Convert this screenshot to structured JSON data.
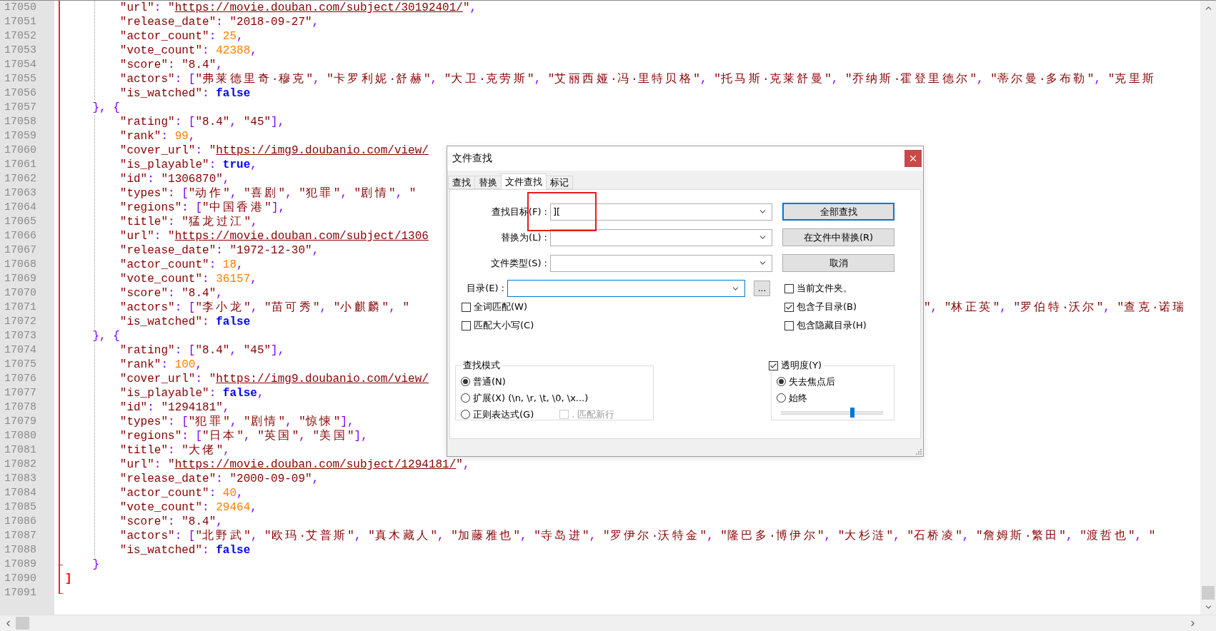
{
  "editor": {
    "lines": [
      {
        "number": "17050",
        "text": "        \"url\": \"https://movie.douban.com/subject/30192401/\","
      },
      {
        "number": "17051",
        "text": "        \"release_date\": \"2018-09-27\","
      },
      {
        "number": "17052",
        "text": "        \"actor_count\": 25,"
      },
      {
        "number": "17053",
        "text": "        \"vote_count\": 42388,"
      },
      {
        "number": "17054",
        "text": "        \"score\": \"8.4\","
      },
      {
        "number": "17055",
        "text": "        \"actors\": [\"弗莱德里奇·穆克\", \"卡罗利妮·舒赫\", \"大卫·克劳斯\", \"艾丽西娅·冯·里特贝格\", \"托马斯·克莱舒曼\", \"乔纳斯·霍登里德尔\", \"蒂尔曼·多布勒\", \"克里斯"
      },
      {
        "number": "17056",
        "text": "        \"is_watched\": false"
      },
      {
        "number": "17057",
        "text": "    }, {"
      },
      {
        "number": "17058",
        "text": "        \"rating\": [\"8.4\", \"45\"],"
      },
      {
        "number": "17059",
        "text": "        \"rank\": 99,"
      },
      {
        "number": "17060",
        "text": "        \"cover_url\": \"https://img9.doubanio.com/view/"
      },
      {
        "number": "17061",
        "text": "        \"is_playable\": true,"
      },
      {
        "number": "17062",
        "text": "        \"id\": \"1306870\","
      },
      {
        "number": "17063",
        "text": "        \"types\": [\"动作\", \"喜剧\", \"犯罪\", \"剧情\", \""
      },
      {
        "number": "17064",
        "text": "        \"regions\": [\"中国香港\"],"
      },
      {
        "number": "17065",
        "text": "        \"title\": \"猛龙过江\","
      },
      {
        "number": "17066",
        "text": "        \"url\": \"https://movie.douban.com/subject/1306"
      },
      {
        "number": "17067",
        "text": "        \"release_date\": \"1972-12-30\","
      },
      {
        "number": "17068",
        "text": "        \"actor_count\": 18,"
      },
      {
        "number": "17069",
        "text": "        \"vote_count\": 36157,"
      },
      {
        "number": "17070",
        "text": "        \"score\": \"8.4\","
      },
      {
        "number": "17071",
        "text": "        \"actors\": [\"李小龙\", \"苗可秀\", \"小麒麟\", \"",
        "after_dialog": "\", \"林正英\", \"罗伯特·沃尔\", \"查克·诺瑞"
      },
      {
        "number": "17072",
        "text": "        \"is_watched\": false"
      },
      {
        "number": "17073",
        "text": "    }, {"
      },
      {
        "number": "17074",
        "text": "        \"rating\": [\"8.4\", \"45\"],"
      },
      {
        "number": "17075",
        "text": "        \"rank\": 100,"
      },
      {
        "number": "17076",
        "text": "        \"cover_url\": \"https://img9.doubanio.com/view/"
      },
      {
        "number": "17077",
        "text": "        \"is_playable\": false,"
      },
      {
        "number": "17078",
        "text": "        \"id\": \"1294181\","
      },
      {
        "number": "17079",
        "text": "        \"types\": [\"犯罪\", \"剧情\", \"惊悚\"],"
      },
      {
        "number": "17080",
        "text": "        \"regions\": [\"日本\", \"英国\", \"美国\"],"
      },
      {
        "number": "17081",
        "text": "        \"title\": \"大佬\","
      },
      {
        "number": "17082",
        "text": "        \"url\": \"https://movie.douban.com/subject/1294181/\","
      },
      {
        "number": "17083",
        "text": "        \"release_date\": \"2000-09-09\","
      },
      {
        "number": "17084",
        "text": "        \"actor_count\": 40,"
      },
      {
        "number": "17085",
        "text": "        \"vote_count\": 29464,"
      },
      {
        "number": "17086",
        "text": "        \"score\": \"8.4\","
      },
      {
        "number": "17087",
        "text": "        \"actors\": [\"北野武\", \"欧玛·艾普斯\", \"真木藏人\", \"加藤雅也\", \"寺岛进\", \"罗伊尔·沃特金\", \"隆巴多·博伊尔\", \"大杉涟\", \"石桥凌\", \"詹姆斯·繁田\", \"渡哲也\", \""
      },
      {
        "number": "17088",
        "text": "        \"is_watched\": false"
      },
      {
        "number": "17089",
        "text": "    }",
        "fold_end": true
      },
      {
        "number": "17090",
        "text": "]",
        "brace_match": true
      },
      {
        "number": "17091",
        "fold_end": true
      }
    ]
  },
  "dialog": {
    "title": "文件查找",
    "tabs": [
      {
        "label": "查找",
        "selected": false
      },
      {
        "label": "替换",
        "selected": false
      },
      {
        "label": "文件查找",
        "selected": true
      },
      {
        "label": "标记",
        "selected": false
      }
    ],
    "fields": [
      {
        "label": "查找目标(F) :",
        "value": "][",
        "focused": false
      },
      {
        "label": "替换为(L) :",
        "focused": false
      },
      {
        "label": "文件类型(S) :",
        "focused": false
      }
    ],
    "buttons": [
      {
        "label": "全部查找",
        "focused": true
      },
      {
        "label": "在文件中替换(R)",
        "focused": false
      },
      {
        "label": "取消",
        "focused": false
      }
    ],
    "directory": {
      "label": "目录(E) :",
      "focused": true,
      "browse_label": "..."
    },
    "current_folder": {
      "label": "当前文件夹。",
      "checked": false
    },
    "options_left": [
      {
        "label": "全词匹配(W)",
        "checked": false
      },
      {
        "label": "匹配大小写(C)",
        "checked": false
      }
    ],
    "options_right": [
      {
        "label": "包含子目录(B)",
        "checked": true
      },
      {
        "label": "包含隐藏目录(H)",
        "checked": false
      }
    ],
    "search_mode": {
      "title": "查找模式",
      "options": [
        {
          "label": "普通(N)",
          "selected": true
        },
        {
          "label": "扩展(X) (\\n, \\r, \\t, \\0, \\x...)",
          "selected": false
        },
        {
          "label": "正则表达式(G)",
          "selected": false
        }
      ],
      "newline": {
        "label": ". 匹配新行",
        "checked": false,
        "disabled": true
      }
    },
    "transparency": {
      "label": "透明度(Y)",
      "checked": true,
      "options": [
        {
          "label": "失去焦点后",
          "selected": true
        },
        {
          "label": "始终",
          "selected": false
        }
      ],
      "level": 0.71
    }
  }
}
